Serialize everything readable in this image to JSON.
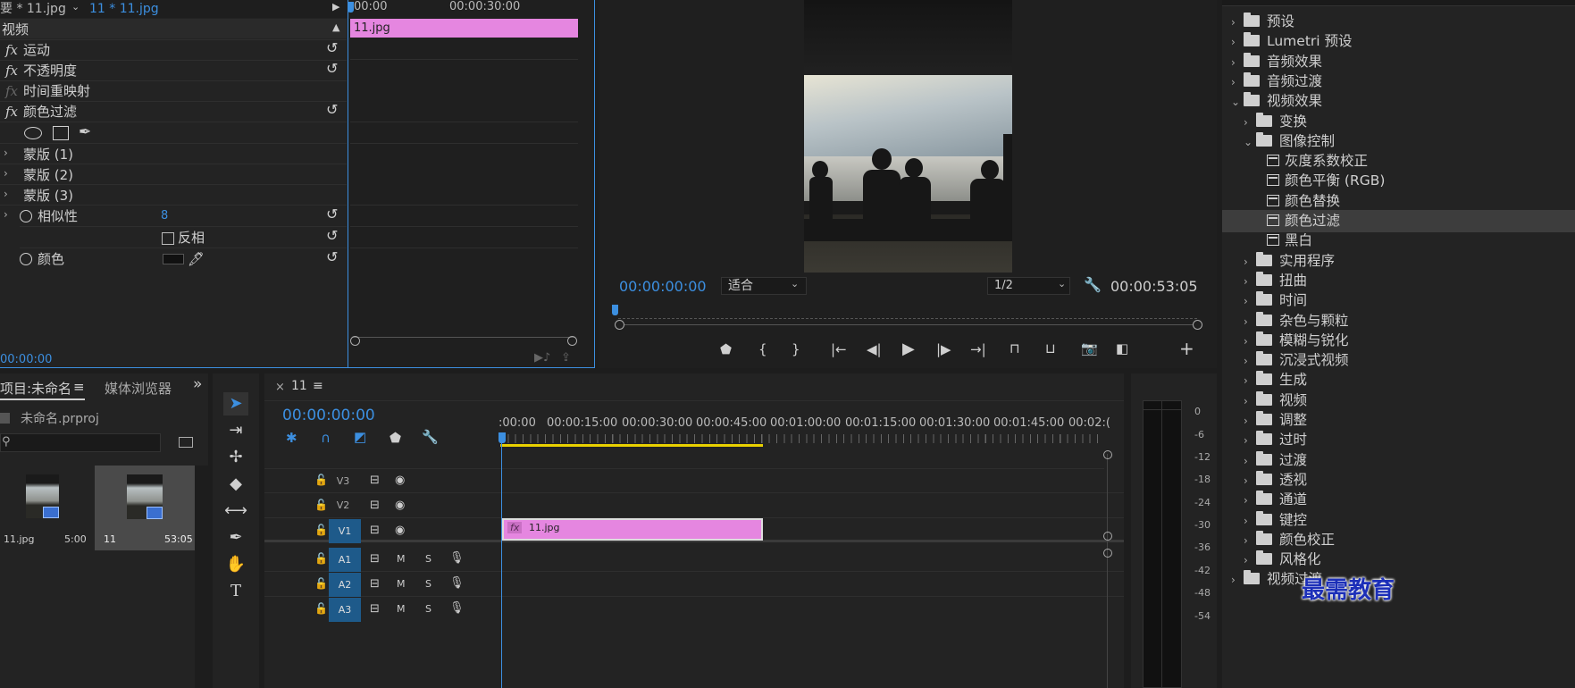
{
  "colors": {
    "accent": "#3c8fe0",
    "clip": "#e586e0",
    "selection": "#3d3d3d",
    "playhead": "#3c8fe0",
    "workbar": "#e8d000",
    "watermark": "#1c2fb8"
  },
  "effect_controls": {
    "tab_source": "要 * 11.jpg",
    "tab_seq": "11 * 11.jpg",
    "section": "视频",
    "fx_items": [
      {
        "label": "运动"
      },
      {
        "label": "不透明度"
      },
      {
        "label": "时间重映射"
      },
      {
        "label": "颜色过滤"
      }
    ],
    "masks": [
      "蒙版 (1)",
      "蒙版 (2)",
      "蒙版 (3)"
    ],
    "similarity_label": "相似性",
    "similarity_value": "8",
    "invert_label": "反相",
    "color_label": "颜色",
    "timecode": "00:00:00",
    "ruler": [
      "00:00",
      "00:00:30:00"
    ],
    "clip": "11.jpg"
  },
  "program": {
    "timecode": "00:00:00:00",
    "fit": "适合",
    "res": "1/2",
    "duration": "00:00:53:05"
  },
  "project": {
    "tab": "项目:未命名",
    "tab_menu": "≡",
    "tab2": "媒体浏览器",
    "more": "»",
    "file": "未命名.prproj",
    "items": [
      {
        "name": "11.jpg",
        "dur": "5:00"
      },
      {
        "name": "11",
        "dur": "53:05"
      }
    ]
  },
  "timeline": {
    "tab": "11",
    "close": "×",
    "menu": "≡",
    "timecode": "00:00:00:00",
    "ruler": [
      ":00:00",
      "00:00:15:00",
      "00:00:30:00",
      "00:00:45:00",
      "00:01:00:00",
      "00:01:15:00",
      "00:01:30:00",
      "00:01:45:00",
      "00:02:("
    ],
    "tracks": [
      {
        "name": "V3",
        "kind": "video",
        "active": false
      },
      {
        "name": "V2",
        "kind": "video",
        "active": false
      },
      {
        "name": "V1",
        "kind": "video",
        "active": true
      },
      {
        "name": "A1",
        "kind": "audio",
        "active": true
      },
      {
        "name": "A2",
        "kind": "audio",
        "active": true
      },
      {
        "name": "A3",
        "kind": "audio",
        "active": true
      }
    ],
    "m": "M",
    "s": "S",
    "clip": "11.jpg",
    "clip_fx": "fx"
  },
  "meter": [
    "0",
    "-6",
    "-12",
    "-18",
    "-24",
    "-30",
    "-36",
    "-42",
    "-48",
    "-54"
  ],
  "effects": [
    {
      "label": "预设",
      "level": 0,
      "kind": "preset",
      "open": false
    },
    {
      "label": "Lumetri 预设",
      "level": 0,
      "kind": "preset",
      "open": false
    },
    {
      "label": "音频效果",
      "level": 0,
      "kind": "folder",
      "open": false
    },
    {
      "label": "音频过渡",
      "level": 0,
      "kind": "folder",
      "open": false
    },
    {
      "label": "视频效果",
      "level": 0,
      "kind": "folder",
      "open": true
    },
    {
      "label": "变换",
      "level": 1,
      "kind": "folder",
      "open": false
    },
    {
      "label": "图像控制",
      "level": 1,
      "kind": "folder",
      "open": true
    },
    {
      "label": "灰度系数校正",
      "level": 2,
      "kind": "fx"
    },
    {
      "label": "颜色平衡 (RGB)",
      "level": 2,
      "kind": "fx"
    },
    {
      "label": "颜色替换",
      "level": 2,
      "kind": "fx"
    },
    {
      "label": "颜色过滤",
      "level": 2,
      "kind": "fx",
      "selected": true
    },
    {
      "label": "黑白",
      "level": 2,
      "kind": "fx"
    },
    {
      "label": "实用程序",
      "level": 1,
      "kind": "folder",
      "open": false
    },
    {
      "label": "扭曲",
      "level": 1,
      "kind": "folder",
      "open": false
    },
    {
      "label": "时间",
      "level": 1,
      "kind": "folder",
      "open": false
    },
    {
      "label": "杂色与颗粒",
      "level": 1,
      "kind": "folder",
      "open": false
    },
    {
      "label": "模糊与锐化",
      "level": 1,
      "kind": "folder",
      "open": false
    },
    {
      "label": "沉浸式视频",
      "level": 1,
      "kind": "folder",
      "open": false
    },
    {
      "label": "生成",
      "level": 1,
      "kind": "folder",
      "open": false
    },
    {
      "label": "视频",
      "level": 1,
      "kind": "folder",
      "open": false
    },
    {
      "label": "调整",
      "level": 1,
      "kind": "folder",
      "open": false
    },
    {
      "label": "过时",
      "level": 1,
      "kind": "folder",
      "open": false
    },
    {
      "label": "过渡",
      "level": 1,
      "kind": "folder",
      "open": false
    },
    {
      "label": "透视",
      "level": 1,
      "kind": "folder",
      "open": false
    },
    {
      "label": "通道",
      "level": 1,
      "kind": "folder",
      "open": false
    },
    {
      "label": "键控",
      "level": 1,
      "kind": "folder",
      "open": false
    },
    {
      "label": "颜色校正",
      "level": 1,
      "kind": "folder",
      "open": false
    },
    {
      "label": "风格化",
      "level": 1,
      "kind": "folder",
      "open": false
    },
    {
      "label": "视频过渡",
      "level": 0,
      "kind": "folder",
      "open": false
    }
  ],
  "watermark": "最需教育"
}
